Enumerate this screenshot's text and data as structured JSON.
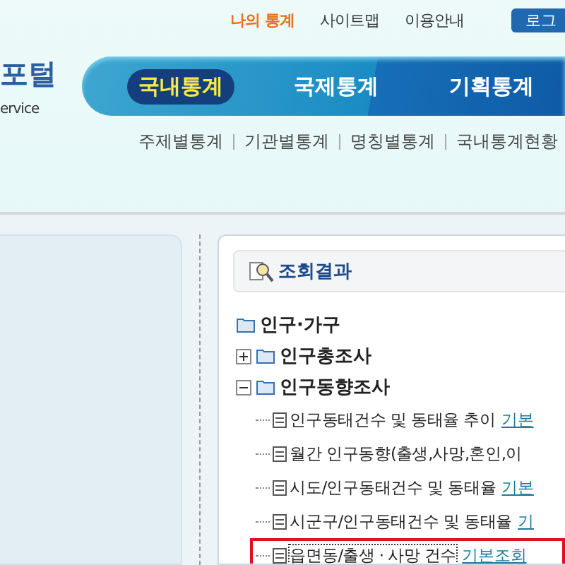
{
  "logo": {
    "title": "포털",
    "subtitle": "ervice"
  },
  "top_links": [
    {
      "label": "나의 통계",
      "highlighted": true
    },
    {
      "label": "사이트맵",
      "highlighted": false
    },
    {
      "label": "이용안내",
      "highlighted": false
    }
  ],
  "login_button": "로그",
  "main_tabs": [
    {
      "label": "국내통계",
      "selected": true
    },
    {
      "label": "국제통계",
      "selected": false
    },
    {
      "label": "기획통계",
      "selected": false
    }
  ],
  "sub_links": [
    "주제별통계",
    "기관별통계",
    "명칭별통계",
    "국내통계현황"
  ],
  "results": {
    "title": "조회결과",
    "tree": {
      "label": "인구·가구",
      "children": [
        {
          "label": "인구총조사",
          "expanded": false
        },
        {
          "label": "인구동향조사",
          "expanded": true,
          "children": [
            {
              "text": "인구동태건수 및 동태율 추이",
              "link": "기본",
              "selected": false
            },
            {
              "text": "월간 인구동향(출생,사망,혼인,이",
              "selected": false
            },
            {
              "text": "시도/인구동태건수 및 동태율",
              "link": "기본",
              "selected": false
            },
            {
              "text": "시군구/인구동태건수 및 동태율",
              "link": "기",
              "selected": false
            },
            {
              "text": "읍면동/출생 · 사망 건수",
              "link": "기본조회",
              "selected": true
            }
          ]
        }
      ]
    }
  }
}
